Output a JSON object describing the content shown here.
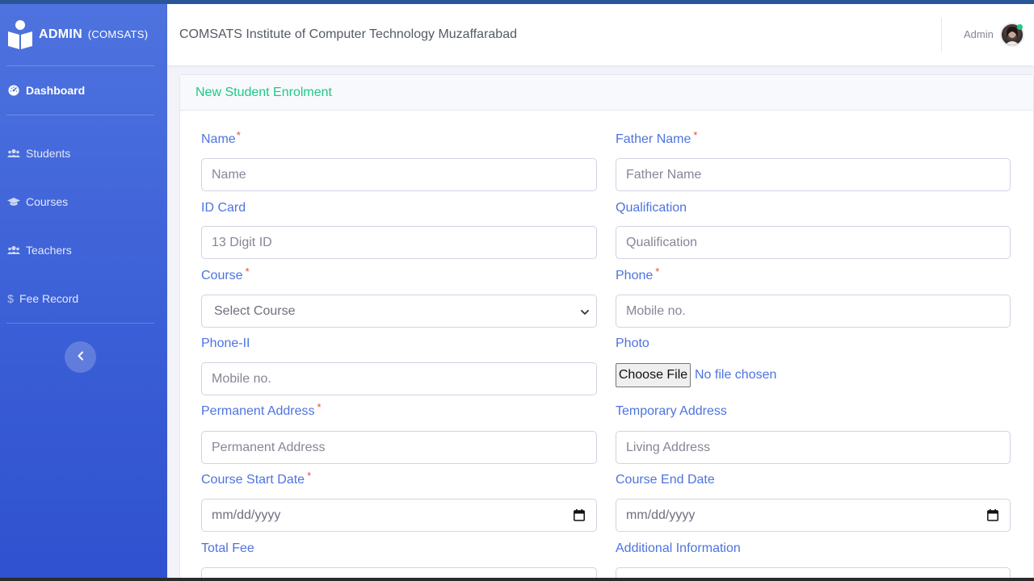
{
  "brand": {
    "name": "ADMIN",
    "sub": "(COMSATS)"
  },
  "header": {
    "title": "COMSATS Institute of Computer Technology Muzaffarabad",
    "user": "Admin"
  },
  "sidebar": {
    "items": [
      {
        "label": "Dashboard",
        "icon": "dashboard-icon"
      },
      {
        "label": "Students",
        "icon": "users-icon"
      },
      {
        "label": "Courses",
        "icon": "graduation-cap-icon"
      },
      {
        "label": "Teachers",
        "icon": "users-icon"
      },
      {
        "label": "Fee Record",
        "icon": "dollar-icon"
      }
    ]
  },
  "card": {
    "title": "New Student Enrolment"
  },
  "form": {
    "name": {
      "label": "Name",
      "required": "*",
      "placeholder": "Name"
    },
    "father_name": {
      "label": "Father Name",
      "required": "*",
      "placeholder": "Father Name"
    },
    "id_card": {
      "label": "ID Card",
      "placeholder": "13 Digit ID"
    },
    "qualification": {
      "label": "Qualification",
      "placeholder": "Qualification"
    },
    "course": {
      "label": "Course",
      "required": "*",
      "selected": "Select Course"
    },
    "phone": {
      "label": "Phone",
      "required": "*",
      "placeholder": "Mobile no."
    },
    "phone2": {
      "label": "Phone-II",
      "placeholder": "Mobile no."
    },
    "photo": {
      "label": "Photo",
      "button": "Choose File",
      "status": "No file chosen"
    },
    "permanent_address": {
      "label": "Permanent Address",
      "required": "*",
      "placeholder": "Permanent Address"
    },
    "temporary_address": {
      "label": "Temporary Address",
      "placeholder": "Living Address"
    },
    "course_start": {
      "label": "Course Start Date",
      "required": "*",
      "placeholder": "mm/dd/yyyy"
    },
    "course_end": {
      "label": "Course End Date",
      "placeholder": "mm/dd/yyyy"
    },
    "total_fee": {
      "label": "Total Fee"
    },
    "additional_info": {
      "label": "Additional Information"
    }
  },
  "colors": {
    "primary": "#4e73df",
    "success": "#1cc88a",
    "danger": "#e74a3b"
  }
}
